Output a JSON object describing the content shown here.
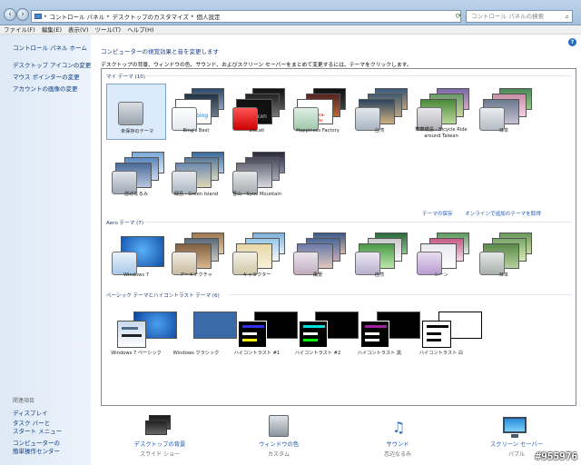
{
  "breadcrumb": [
    "コントロール パネル",
    "デスクトップのカスタマイズ",
    "個人設定"
  ],
  "search": {
    "placeholder": "コントロール パネルの検索"
  },
  "menu": [
    "ファイル(F)",
    "編集(E)",
    "表示(V)",
    "ツール(T)",
    "ヘルプ(H)"
  ],
  "sidebar": {
    "home": "コントロール パネル ホーム",
    "links": [
      "デスクトップ アイコンの変更",
      "マウス ポインターの変更",
      "アカウントの画像の変更"
    ],
    "related_heading": "関連項目",
    "related": [
      "ディスプレイ",
      "タスク バーと\nスタート メニュー",
      "コンピューターの\n簡単操作センター"
    ]
  },
  "main": {
    "title": "コンピューターの視覚効果と音を変更します",
    "description": "デスクトップの背景、ウィンドウの色、サウンド、およびスクリーン セーバーをまとめて変更するには、テーマをクリックします。",
    "sections": [
      {
        "heading": "マイ テーマ (10)"
      },
      {
        "heading": "Aero テーマ (7)"
      },
      {
        "heading": "ベーシック テーマとハイコントラスト テーマ (6)"
      }
    ],
    "my_themes": [
      "未保存のテーマ",
      "Bing's Best",
      "Ducati",
      "Happiness Factory",
      "台湾",
      "華華蝶島 - Bicycle Ride\naround Taiwan",
      "日本",
      "恋辺なるみ",
      "緑島 - Green Island",
      "雪山 - Syue Mountain"
    ],
    "theme_links": [
      "テーマの保存",
      "オンラインで追加のテーマを取得"
    ],
    "aero_themes": [
      "Windows 7",
      "アーキテクチャ",
      "キャラクター",
      "風景",
      "自然",
      "シーン",
      "日本"
    ],
    "basic_themes": [
      "Windows 7 ベーシック",
      "Windows クラシック",
      "ハイコントラスト #1",
      "ハイコントラスト #2",
      "ハイコントラスト 黒",
      "ハイコントラスト 白"
    ],
    "logos": [
      "bing",
      "DUCATI",
      "Coca-Cola"
    ]
  },
  "bottom": [
    {
      "label": "デスクトップの背景",
      "sub": "スライド ショー",
      "icon": "desktop-background-icon"
    },
    {
      "label": "ウィンドウの色",
      "sub": "カスタム",
      "icon": "window-color-icon"
    },
    {
      "label": "サウンド",
      "sub": "恋辺なるみ",
      "icon": "sound-icon"
    },
    {
      "label": "スクリーン セーバー",
      "sub": "バブル",
      "icon": "screen-saver-icon"
    }
  ],
  "watermark": "#955976",
  "colors": {
    "link": "#1a55b8",
    "sidebar_bg": "#dde9f6",
    "selected": "#dcebfc"
  }
}
